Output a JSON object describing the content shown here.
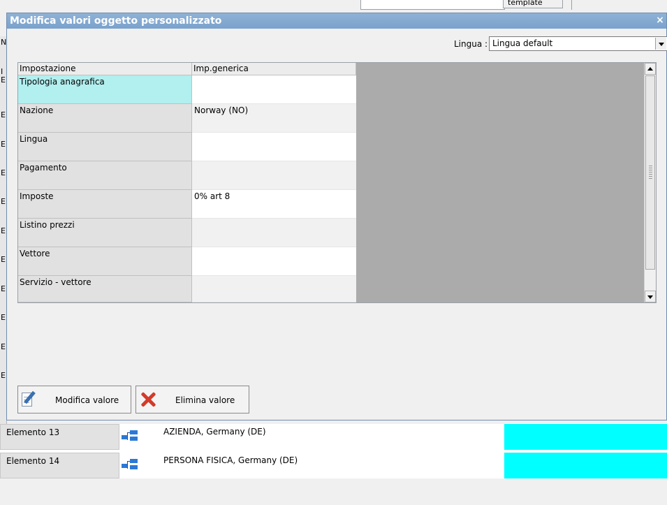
{
  "background": {
    "top_button_label": "template",
    "left_letters": [
      "N",
      "I",
      "E",
      "E",
      "E",
      "E",
      "E",
      "E",
      "E",
      "E",
      "E",
      "E",
      "E"
    ],
    "rows": [
      {
        "name": "Elemento 13",
        "value": "AZIENDA, Germany (DE)"
      },
      {
        "name": "Elemento 14",
        "value": "PERSONA FISICA, Germany (DE)"
      }
    ],
    "accent_color": "#00ffff"
  },
  "dialog": {
    "title": "Modifica valori oggetto personalizzato",
    "close_label": "×",
    "lingua_label": "Lingua :",
    "lingua_value": "Lingua default",
    "grid": {
      "headers": [
        "Impostazione",
        "Imp.generica"
      ],
      "rows": [
        {
          "key": "Tipologia anagrafica",
          "value": ""
        },
        {
          "key": "Nazione",
          "value": "Norway (NO)"
        },
        {
          "key": "Lingua",
          "value": ""
        },
        {
          "key": "Pagamento",
          "value": ""
        },
        {
          "key": "Imposte",
          "value": "0% art 8"
        },
        {
          "key": "Listino prezzi",
          "value": ""
        },
        {
          "key": "Vettore",
          "value": ""
        },
        {
          "key": "Servizio - vettore",
          "value": ""
        }
      ],
      "selected_color": "#b2efef"
    },
    "buttons": {
      "edit_label": "Modifica valore",
      "delete_label": "Elimina valore"
    },
    "icons": {
      "edit": "edit-document-icon",
      "delete": "red-x-icon"
    }
  }
}
